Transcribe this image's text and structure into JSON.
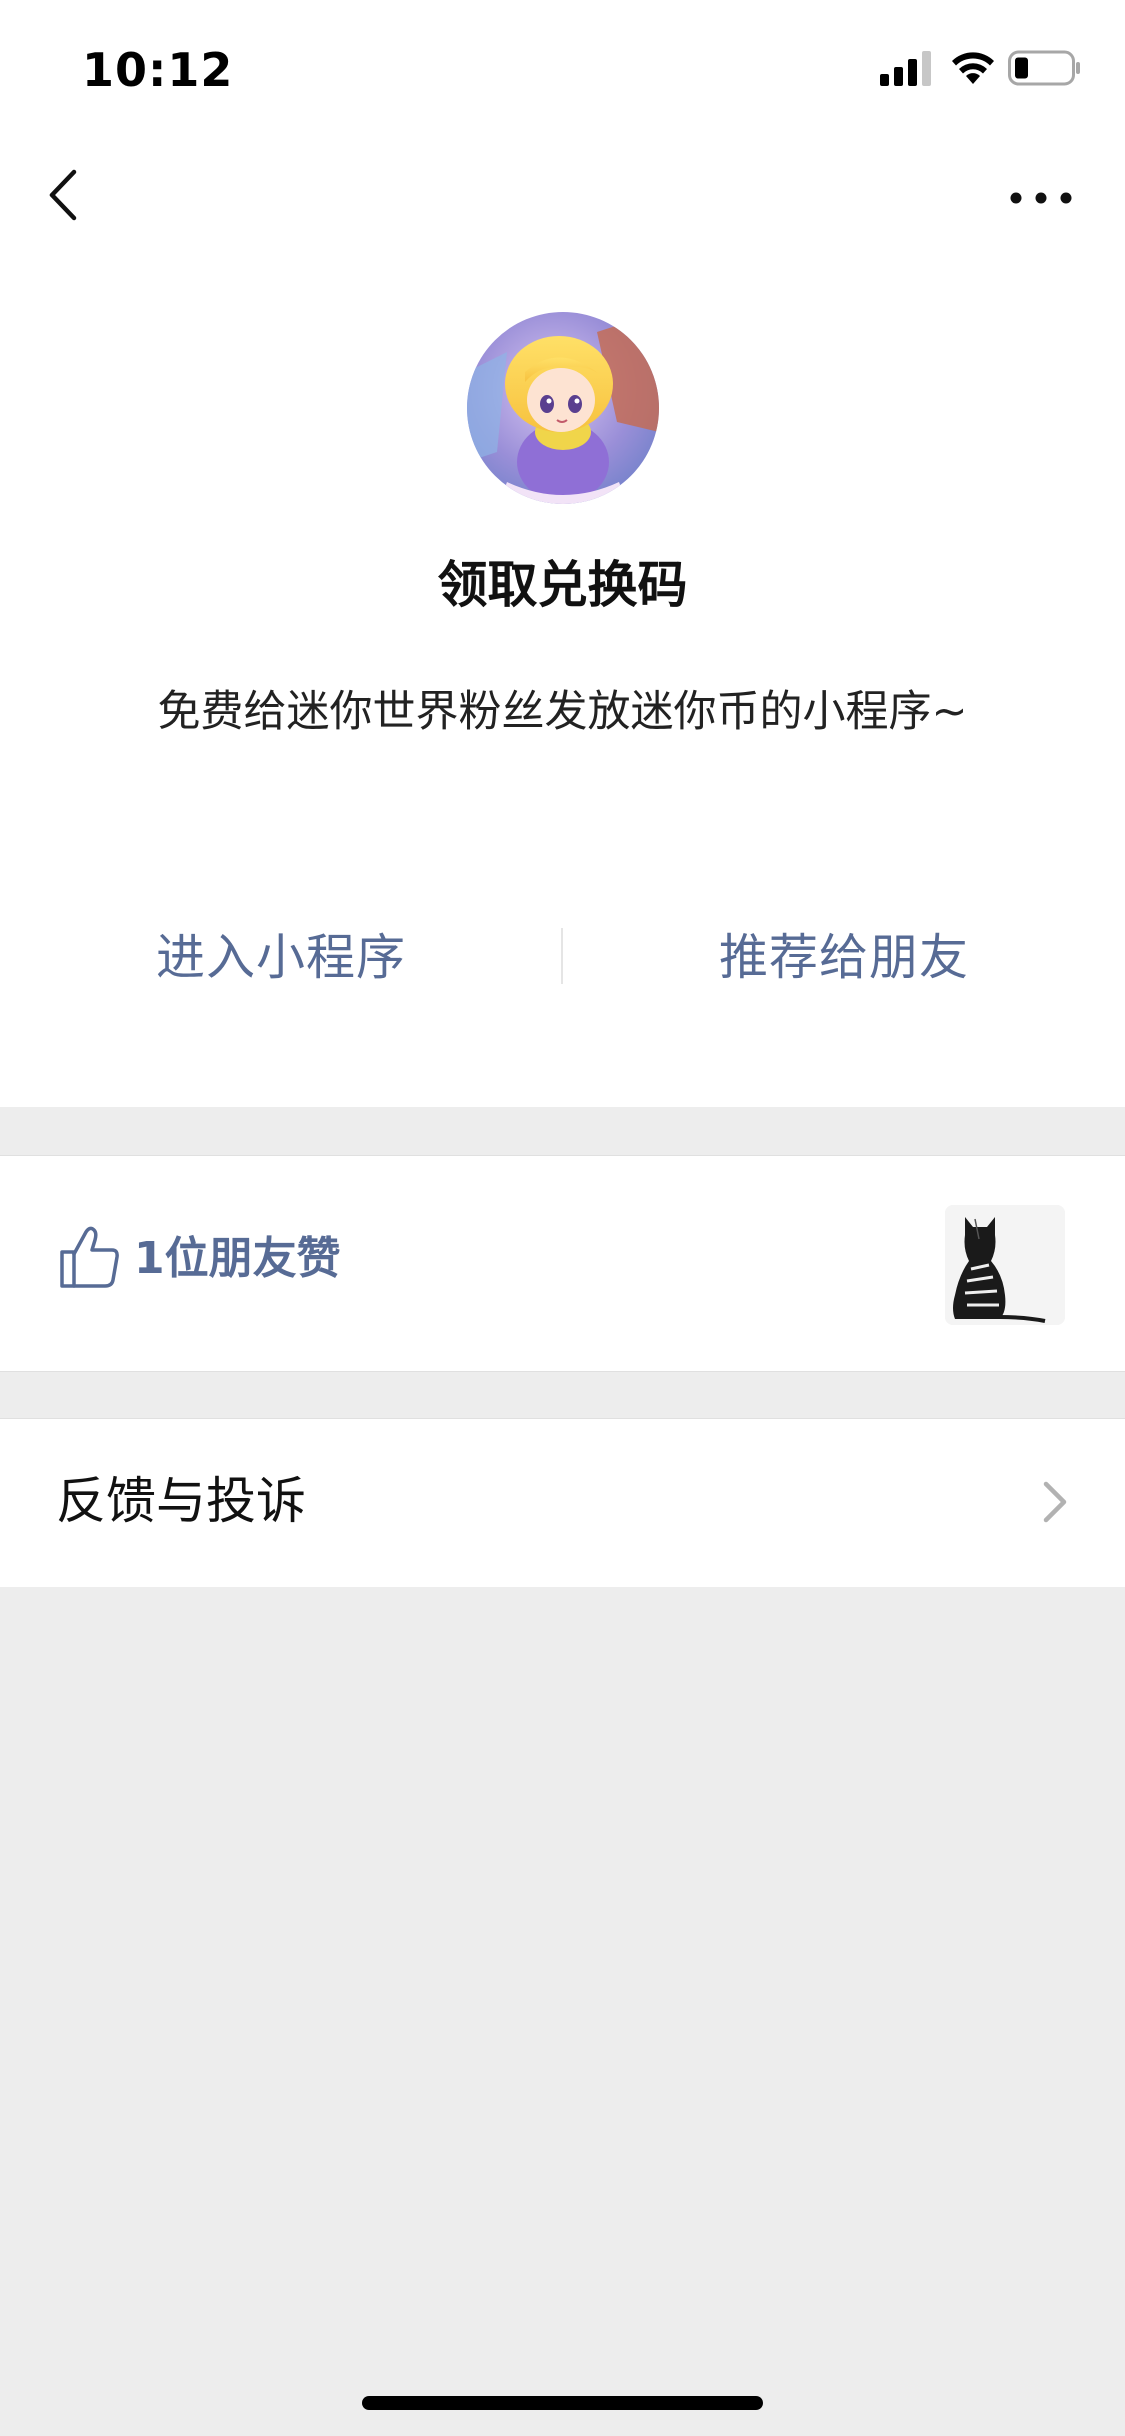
{
  "status_bar": {
    "time": "10:12"
  },
  "nav": {
    "back_icon": "chevron-left-icon",
    "more_icon": "more-horizontal-icon"
  },
  "mini_program": {
    "name": "领取兑换码",
    "description": "免费给迷你世界粉丝发放迷你币的小程序~",
    "enter_label": "进入小程序",
    "recommend_label": "推荐给朋友"
  },
  "likes": {
    "text": "1位朋友赞",
    "icon": "thumbs-up-icon"
  },
  "feedback": {
    "label": "反馈与投诉",
    "icon": "chevron-right-icon"
  },
  "colors": {
    "link": "#576b95",
    "background": "#ededed",
    "surface": "#ffffff"
  }
}
